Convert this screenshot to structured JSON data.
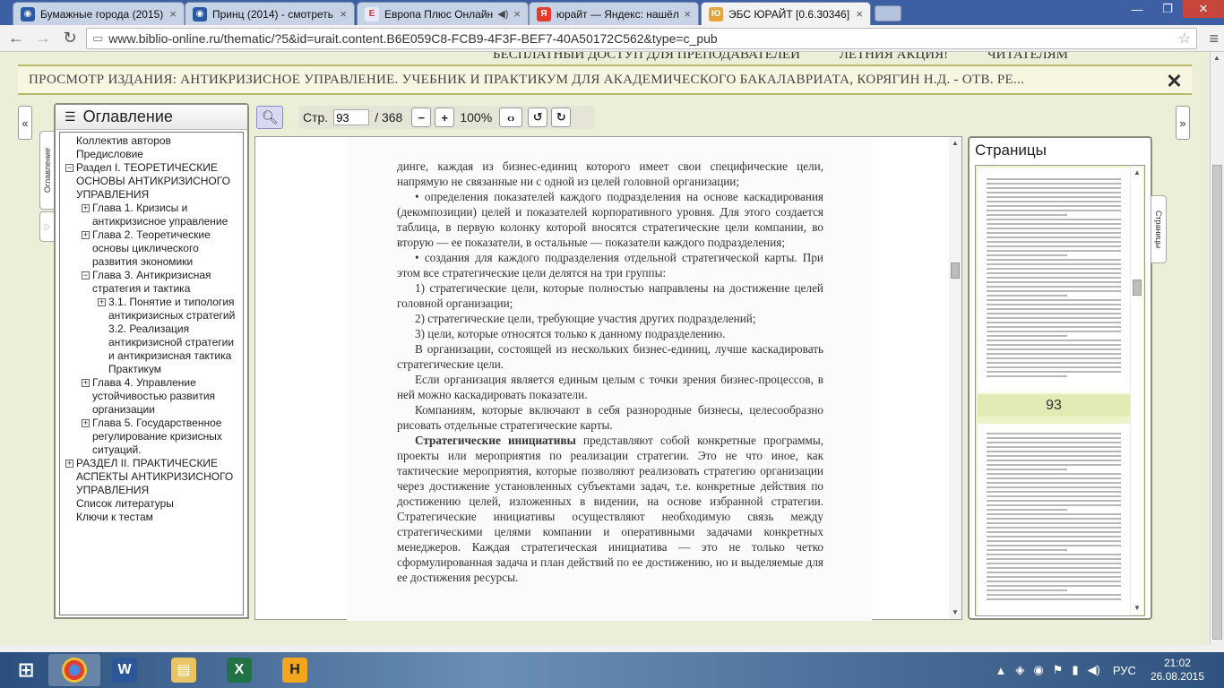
{
  "browser": {
    "tabs": [
      {
        "label": "Бумажные города (2015)",
        "icon": "globe-icon",
        "color": "#2a5aa5"
      },
      {
        "label": "Принц (2014) - смотреть",
        "icon": "globe-icon",
        "color": "#2a5aa5"
      },
      {
        "label": "Европа Плюс Онлайн",
        "icon": "europa-plus-icon",
        "color": "#e8e8ff",
        "muted_icon": "speaker-icon"
      },
      {
        "label": "юрайт — Яндекс: нашёлс",
        "icon": "yandex-icon",
        "color": "#e83a2a"
      },
      {
        "label": "ЭБС ЮРАЙТ [0.6.30346]",
        "icon": "urait-icon",
        "color": "#e8a23a",
        "active": true
      }
    ],
    "url": "www.biblio-online.ru/thematic/?5&id=urait.content.B6E059C8-FCB9-4F3F-BEF7-40A50172C562&type=c_pub"
  },
  "site": {
    "promo": [
      "БЕСПЛАТНЫЙ ДОСТУП ДЛЯ ПРЕПОДАВАТЕЛЕЙ",
      "ЛЕТНИЯ АКЦИЯ!",
      "ЧИТАТЕЛЯМ"
    ],
    "view_title": "ПРОСМОТР ИЗДАНИЯ: АНТИКРИЗИСНОЕ УПРАВЛЕНИЕ. УЧЕБНИК И ПРАКТИКУМ ДЛЯ АКАДЕМИЧЕСКОГО БАКАЛАВРИАТА, КОРЯГИН Н.Д. - ОТВ. РЕ...",
    "toc_tab_label": "Оглавление",
    "pages_tab_label": "Страницы"
  },
  "toc": {
    "title": "Оглавление",
    "items": [
      {
        "text": "Коллектив авторов",
        "level": 0
      },
      {
        "text": "Предисловие",
        "level": 0
      },
      {
        "text": "Раздел I. ТЕОРЕТИЧЕСКИЕ ОСНОВЫ АНТИКРИЗИСНОГО УПРАВЛЕНИЯ",
        "level": 0,
        "toggle": "−"
      },
      {
        "text": "Глава 1. Кризисы и антикризисное управление",
        "level": 1,
        "toggle": "+"
      },
      {
        "text": "Глава 2. Теоретические основы циклического развития экономики",
        "level": 1,
        "toggle": "+"
      },
      {
        "text": "Глава 3. Антикризисная стратегия и тактика",
        "level": 1,
        "toggle": "−"
      },
      {
        "text": "3.1. Понятие и типология антикризисных стратегий",
        "level": 2,
        "toggle": "+"
      },
      {
        "text": "3.2. Реализация антикризисной стратегии и антикризисная тактика",
        "level": 2
      },
      {
        "text": "Практикум",
        "level": 2
      },
      {
        "text": "Глава 4. Управление устойчивостью развития организации",
        "level": 1,
        "toggle": "+"
      },
      {
        "text": "Глава 5. Государственное регулирование кризисных ситуаций.",
        "level": 1,
        "toggle": "+"
      },
      {
        "text": "РАЗДЕЛ II. ПРАКТИЧЕСКИЕ АСПЕКТЫ АНТИКРИЗИСНОГО УПРАВЛЕНИЯ",
        "level": 0,
        "toggle": "+"
      },
      {
        "text": "Список литературы",
        "level": 0
      },
      {
        "text": "Ключи к тестам",
        "level": 0
      }
    ]
  },
  "toolbar": {
    "page_label": "Стр.",
    "page_value": "93",
    "page_total": "/ 368",
    "zoom": "100%"
  },
  "document": {
    "paragraphs": [
      {
        "text": "динге, каждая из бизнес-единиц которого имеет свои специфические цели, напрямую не связанные ни с одной из целей головной организации;",
        "indent": false
      },
      {
        "text": "• определения показателей каждого подразделения на основе каскадирования (декомпозиции) целей и показателей корпоративного уровня. Для этого создается таблица, в первую колонку которой вносятся стратегические цели компании, во вторую — ее показатели, в остальные — показатели каждого подразделения;",
        "indent": true
      },
      {
        "text": "• создания для каждого подразделения отдельной стратегической карты. При этом все стратегические цели делятся на три группы:",
        "indent": true
      },
      {
        "text": "1) стратегические цели, которые полностью направлены на достижение целей головной организации;",
        "indent": true
      },
      {
        "text": "2) стратегические цели, требующие участия других подразделений;",
        "indent": true
      },
      {
        "text": "3) цели, которые относятся только к данному подразделению.",
        "indent": true
      },
      {
        "text": "В организации, состоящей из нескольких бизнес-единиц, лучше каскадировать стратегические цели.",
        "indent": true
      },
      {
        "text": "Если организация является единым целым с точки зрения бизнес-процессов, в ней можно каскадировать показатели.",
        "indent": true
      },
      {
        "text": "Компаниям, которые включают в себя разнородные бизнесы, целесообразно рисовать отдельные стратегические карты.",
        "indent": true
      },
      {
        "bold": "Стратегические инициативы",
        "text": " представляют собой конкретные программы, проекты или мероприятия по реализации стратегии. Это не что иное, как тактические мероприятия, которые позволяют реализовать стратегию организации через достижение установленных субъектами задач, т.е. конкретные действия по достижению целей, изложенных в видении, на основе избранной стратегии. Стратегические инициативы осуществляют необходимую связь между стратегическими целями компании и оперативными задачами конкретных менеджеров. Каждая стратегическая инициатива — это не только четко сформулированная задача и план действий по ее достижению, но и выделяемые для ее достижения ресурсы.",
        "indent": true
      }
    ]
  },
  "pages_panel": {
    "title": "Страницы",
    "current_page": "93"
  },
  "taskbar": {
    "apps": [
      "start-icon",
      "chrome-icon",
      "word-icon",
      "explorer-icon",
      "excel-icon",
      "h-app-icon"
    ],
    "lang": "РУС",
    "time": "21:02",
    "date": "26.08.2015"
  }
}
